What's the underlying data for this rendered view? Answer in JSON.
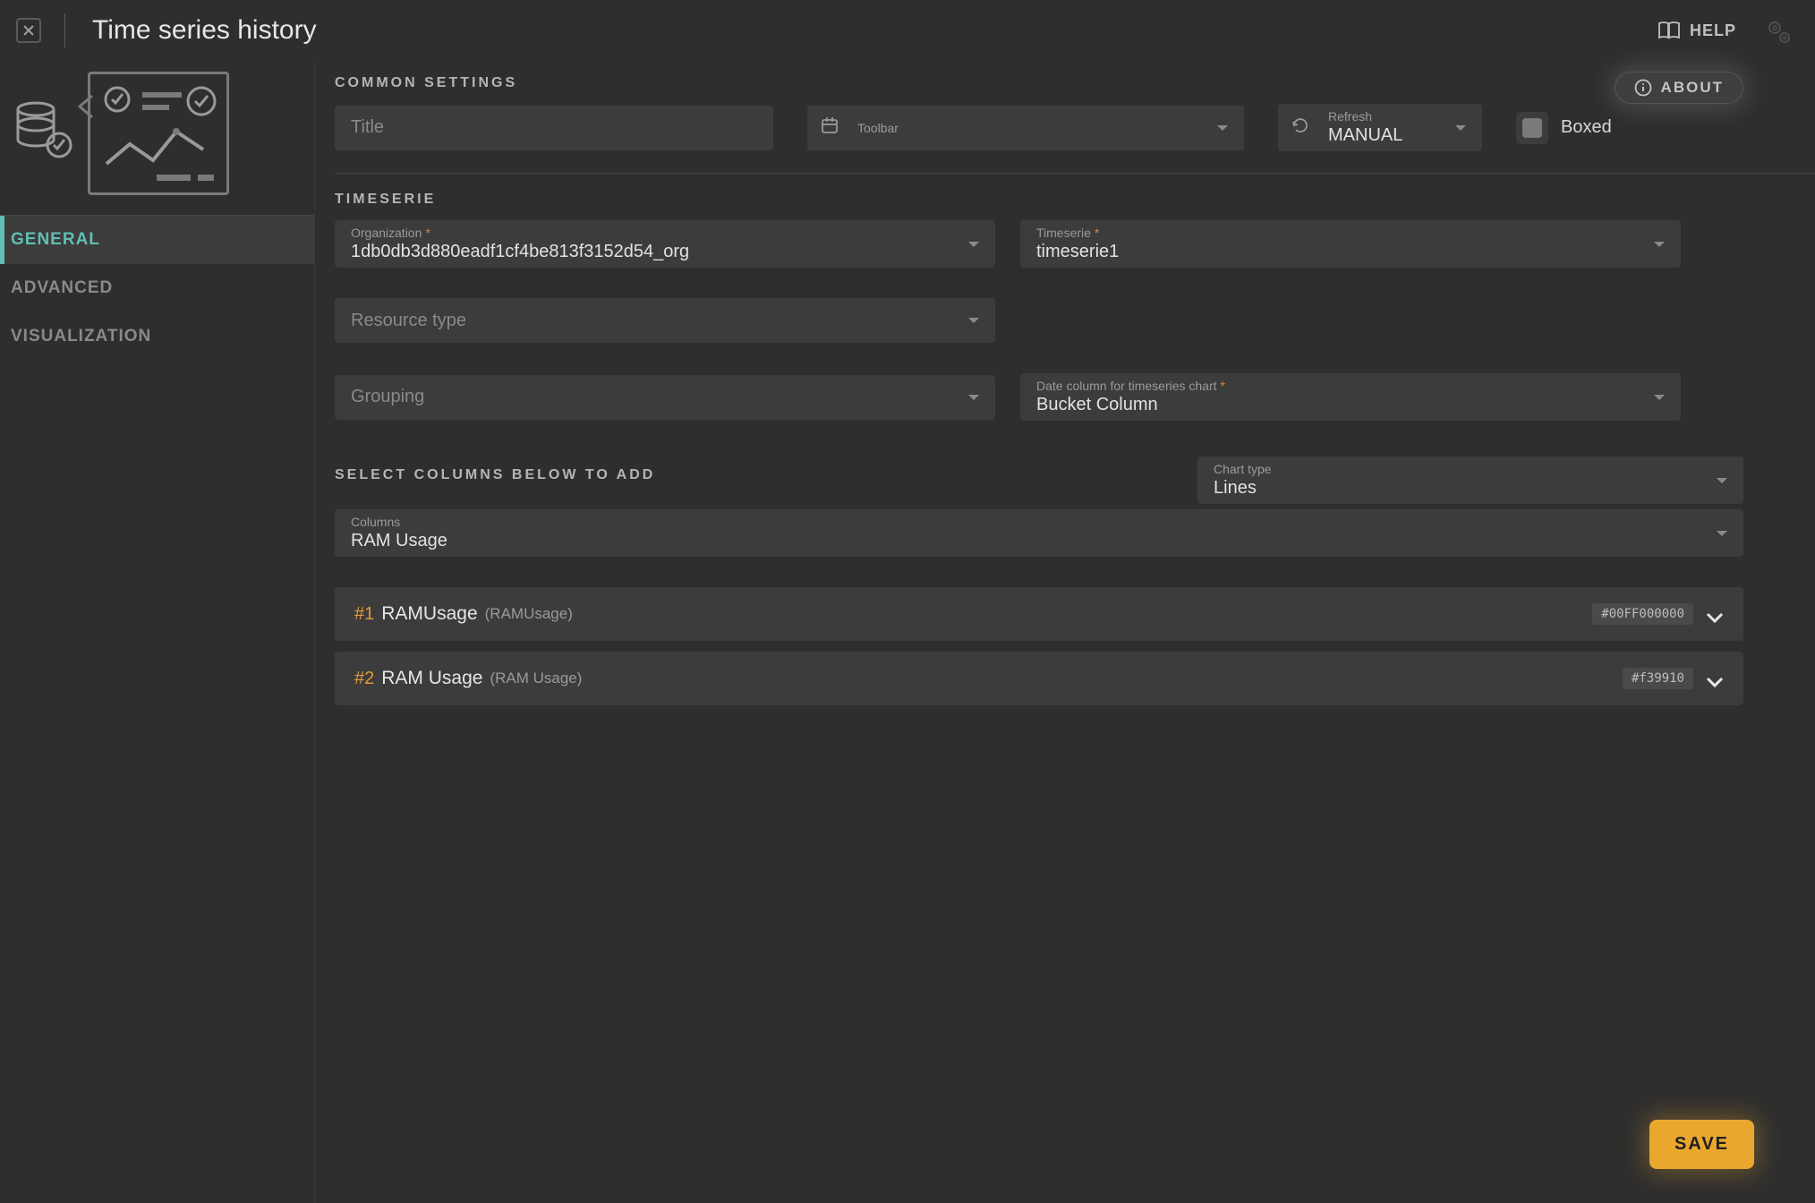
{
  "header": {
    "title": "Time series history",
    "help_label": "HELP",
    "about_label": "ABOUT"
  },
  "sidebar": {
    "tabs": [
      {
        "id": "general",
        "label": "GENERAL",
        "active": true
      },
      {
        "id": "advanced",
        "label": "ADVANCED",
        "active": false
      },
      {
        "id": "visualization",
        "label": "VISUALIZATION",
        "active": false
      }
    ]
  },
  "common": {
    "heading": "COMMON SETTINGS",
    "title_placeholder": "Title",
    "toolbar_label": "Toolbar",
    "refresh_label": "Refresh",
    "refresh_value": "MANUAL",
    "boxed_label": "Boxed"
  },
  "timeserie": {
    "heading": "TIMESERIE",
    "organization_label": "Organization",
    "organization_value": "1db0db3d880eadf1cf4be813f3152d54_org",
    "timeserie_label": "Timeserie",
    "timeserie_value": "timeserie1",
    "resource_type_placeholder": "Resource type",
    "grouping_placeholder": "Grouping",
    "date_column_label": "Date column for timeseries chart",
    "date_column_value": "Bucket Column"
  },
  "columns_section": {
    "heading": "SELECT COLUMNS BELOW TO ADD",
    "chart_type_label": "Chart type",
    "chart_type_value": "Lines",
    "columns_label": "Columns",
    "columns_value": "RAM Usage",
    "items": [
      {
        "idx": "#1",
        "name": "RAMUsage",
        "sub": "(RAMUsage)",
        "color": "#00FF000000"
      },
      {
        "idx": "#2",
        "name": "RAM Usage",
        "sub": "(RAM Usage)",
        "color": "#f39910"
      }
    ]
  },
  "footer": {
    "save_label": "SAVE"
  }
}
